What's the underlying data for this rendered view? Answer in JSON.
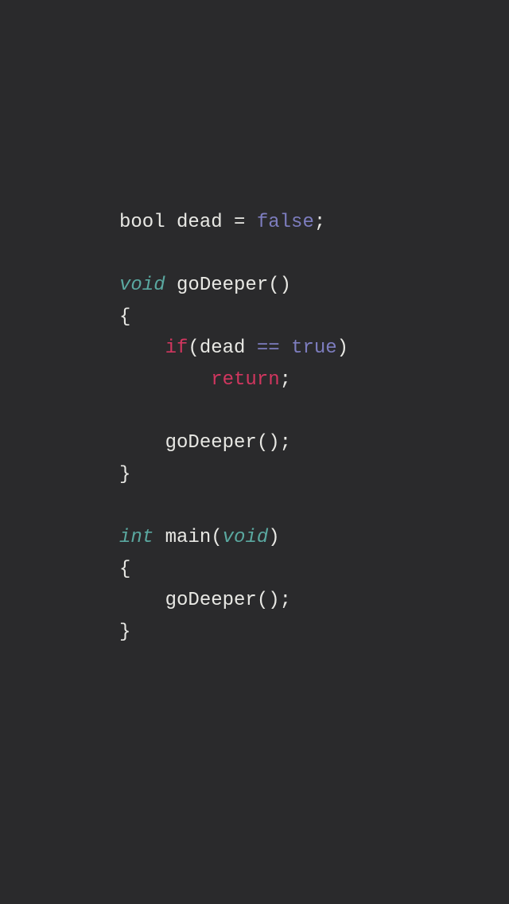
{
  "code": {
    "line1": {
      "type_bool": "bool",
      "identifier": "dead",
      "assign": "=",
      "literal": "false",
      "semi": ";"
    },
    "line3": {
      "type_void": "void",
      "func_name": "goDeeper",
      "parens": "()"
    },
    "line4": {
      "brace": "{"
    },
    "line5": {
      "keyword_if": "if",
      "open_paren": "(",
      "identifier": "dead",
      "eq_op": "==",
      "literal": "true",
      "close_paren": ")"
    },
    "line6": {
      "return_kw": "return",
      "semi": ";"
    },
    "line8": {
      "call": "goDeeper()",
      "semi": ";"
    },
    "line9": {
      "brace": "}"
    },
    "line11": {
      "type_int": "int",
      "func_name": "main",
      "open_paren": "(",
      "void_param": "void",
      "close_paren": ")"
    },
    "line12": {
      "brace": "{"
    },
    "line13": {
      "call": "goDeeper()",
      "semi": ";"
    },
    "line14": {
      "brace": "}"
    }
  }
}
